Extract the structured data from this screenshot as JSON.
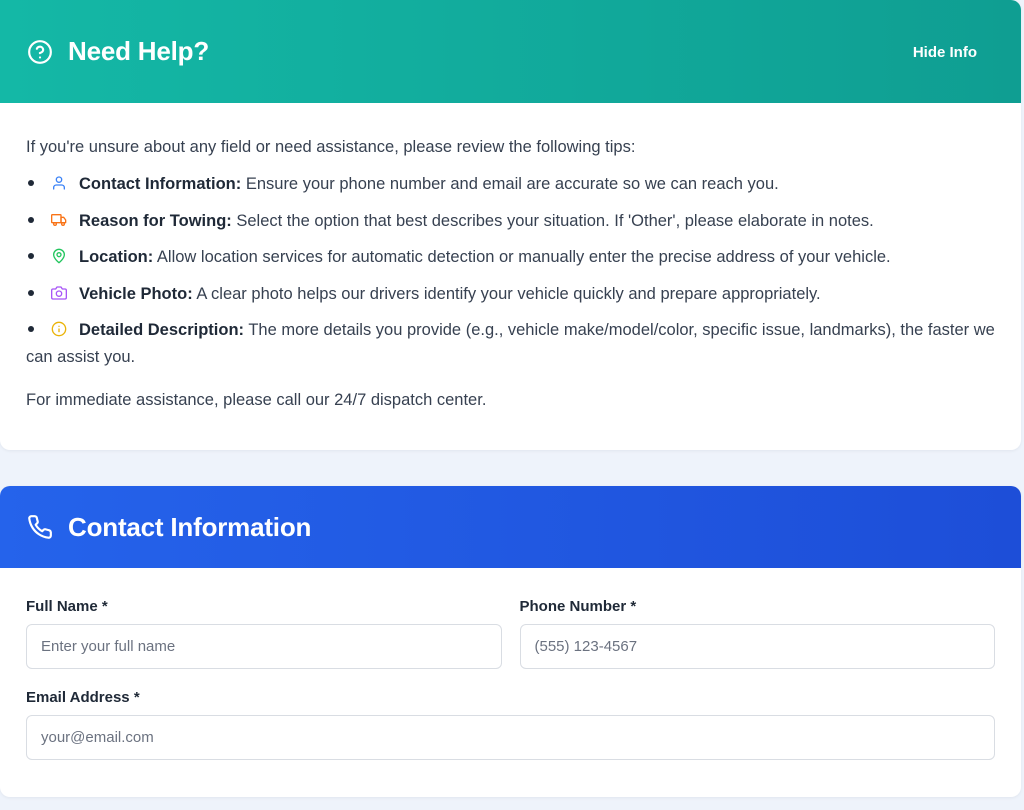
{
  "help": {
    "title": "Need Help?",
    "hide_label": "Hide Info",
    "intro": "If you're unsure about any field or need assistance, please review the following tips:",
    "tips": [
      {
        "icon": "user-icon",
        "title": "Contact Information:",
        "text": " Ensure your phone number and email are accurate so we can reach you.",
        "color": "#3b82f6"
      },
      {
        "icon": "truck-icon",
        "title": "Reason for Towing:",
        "text": " Select the option that best describes your situation. If 'Other', please elaborate in notes.",
        "color": "#f97316"
      },
      {
        "icon": "map-pin-icon",
        "title": "Location:",
        "text": " Allow location services for automatic detection or manually enter the precise address of your vehicle.",
        "color": "#22c55e"
      },
      {
        "icon": "camera-icon",
        "title": "Vehicle Photo:",
        "text": " A clear photo helps our drivers identify your vehicle quickly and prepare appropriately.",
        "color": "#a855f7"
      },
      {
        "icon": "info-icon",
        "title": "Detailed Description:",
        "text": " The more details you provide (e.g., vehicle make/model/color, specific issue, landmarks), the faster we can assist you.",
        "color": "#eab308"
      }
    ],
    "footer": "For immediate assistance, please call our 24/7 dispatch center.",
    "header_color": "#14b8a6"
  },
  "contact": {
    "title": "Contact Information",
    "header_color": "#2563eb",
    "full_name": {
      "label": "Full Name *",
      "placeholder": "Enter your full name"
    },
    "phone": {
      "label": "Phone Number *",
      "placeholder": "(555) 123-4567"
    },
    "email": {
      "label": "Email Address *",
      "placeholder": "your@email.com"
    }
  }
}
